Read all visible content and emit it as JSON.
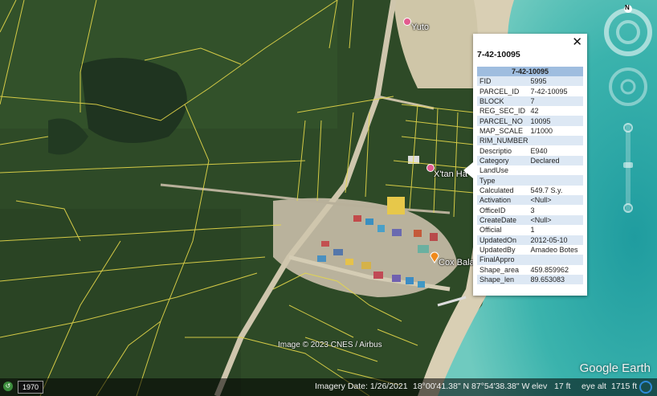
{
  "map": {
    "place_labels": [
      "Yuto",
      "X'tan Ha",
      "Cox Bala"
    ],
    "attribution": "Image © 2023 CNES / Airbus",
    "logo": "Google Earth",
    "colors": {
      "parcel_lines": "#e6d84a",
      "water": "#2fa9a6",
      "vegetation": "#2f4a26"
    }
  },
  "navigation": {
    "compass_label": "N"
  },
  "statusbar": {
    "year": "1970",
    "imagery_date": "Imagery Date: 1/26/2021",
    "latitude": "18°00'41.38\" N",
    "longitude": "87°54'38.38\" W",
    "elev_label": "elev",
    "elev_value": "17 ft",
    "eye_alt_label": "eye alt",
    "eye_alt_value": "1715 ft"
  },
  "popup": {
    "title": "7-42-10095",
    "header": "7-42-10095",
    "close_symbol": "✕",
    "rows": [
      {
        "key": "FID",
        "value": "5995"
      },
      {
        "key": "PARCEL_ID",
        "value": "7-42-10095"
      },
      {
        "key": "BLOCK",
        "value": "7"
      },
      {
        "key": "REG_SEC_ID",
        "value": "42"
      },
      {
        "key": "PARCEL_NO",
        "value": "10095"
      },
      {
        "key": "MAP_SCALE",
        "value": "1/1000"
      },
      {
        "key": "RIM_NUMBER",
        "value": ""
      },
      {
        "key": "Descriptio",
        "value": "E940"
      },
      {
        "key": "Category",
        "value": "Declared"
      },
      {
        "key": "LandUse",
        "value": ""
      },
      {
        "key": "Type",
        "value": ""
      },
      {
        "key": "Calculated",
        "value": "549.7 S.y."
      },
      {
        "key": "Activation",
        "value": "<Null>"
      },
      {
        "key": "OfficeID",
        "value": "3"
      },
      {
        "key": "CreateDate",
        "value": "<Null>"
      },
      {
        "key": "Official",
        "value": "1"
      },
      {
        "key": "UpdatedOn",
        "value": "2012-05-10"
      },
      {
        "key": "UpdatedBy",
        "value": "Amadeo Botes"
      },
      {
        "key": "FinalAppro",
        "value": ""
      },
      {
        "key": "Shape_area",
        "value": "459.859962"
      },
      {
        "key": "Shape_len",
        "value": "89.653083"
      }
    ]
  }
}
